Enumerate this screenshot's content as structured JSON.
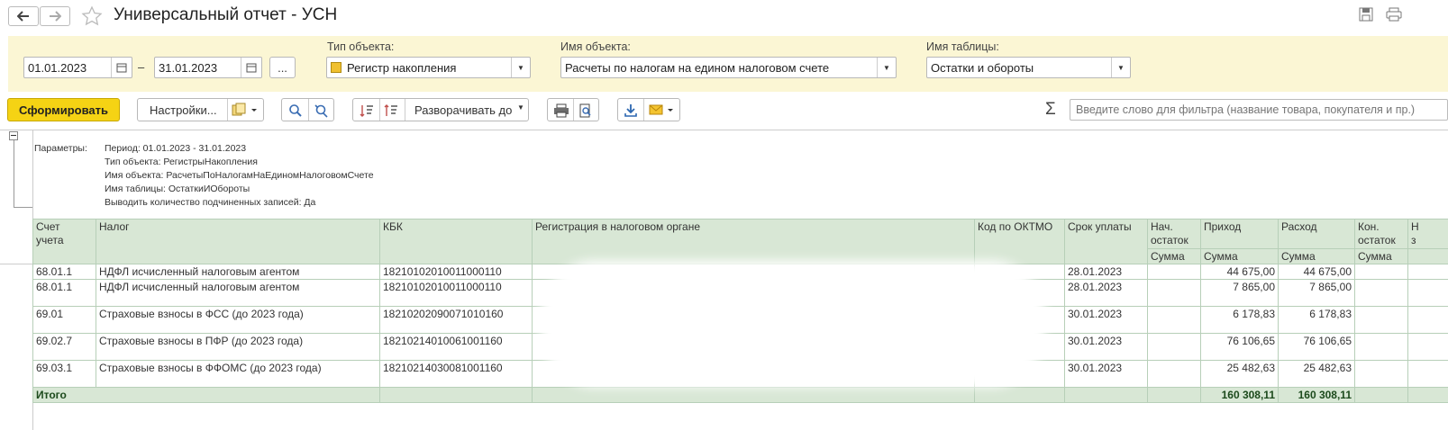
{
  "window": {
    "title": "Универсальный отчет - УСН"
  },
  "filters": {
    "date_from": "01.01.2023",
    "date_dash": "–",
    "date_to": "31.01.2023",
    "period_button": "...",
    "object_type_label": "Тип объекта:",
    "object_type_value": "Регистр накопления",
    "object_name_label": "Имя объекта:",
    "object_name_value": "Расчеты по налогам на едином налоговом счете",
    "table_name_label": "Имя таблицы:",
    "table_name_value": "Остатки и обороты"
  },
  "toolbar": {
    "generate_label": "Сформировать",
    "settings_label": "Настройки...",
    "expand_label": "Разворачивать до",
    "sum_symbol": "Σ",
    "search_placeholder": "Введите слово для фильтра (название товара, покупателя и пр.)"
  },
  "report": {
    "params_label": "Параметры:",
    "params": [
      "Период: 01.01.2023 - 31.01.2023",
      "Тип объекта: РегистрыНакопления",
      "Имя объекта: РасчетыПоНалогамНаЕдиномНалоговомСчете",
      "Имя таблицы: ОстаткиИОбороты",
      "Выводить количество подчиненных записей: Да"
    ],
    "headers": {
      "account_1": "Счет",
      "account_2": "учета",
      "tax": "Налог",
      "kbk": "КБК",
      "registration": "Регистрация в налоговом органе",
      "oktmo": "Код по ОКТМО",
      "due": "Срок уплаты",
      "start_1": "Нач.",
      "start_2": "остаток",
      "income": "Приход",
      "expense": "Расход",
      "end_1": "Кон.",
      "end_2": "остаток",
      "sum_start": "Сумма",
      "sum_income": "Сумма",
      "sum_expense": "Сумма",
      "sum_end": "Сумма",
      "cut_1": "Н",
      "cut_2": "з"
    },
    "rows": [
      {
        "account": "68.01.1",
        "tax": "НДФЛ исчисленный налоговым агентом",
        "kbk": "18210102010011000110",
        "due": "28.01.2023",
        "income": "44 675,00",
        "expense": "44 675,00"
      },
      {
        "account": "68.01.1",
        "tax": "НДФЛ исчисленный налоговым агентом",
        "kbk": "18210102010011000110",
        "due": "28.01.2023",
        "income": "7 865,00",
        "expense": "7 865,00"
      },
      {
        "account": "69.01",
        "tax": "Страховые взносы в ФСС (до 2023 года)",
        "kbk": "18210202090071010160",
        "due": "30.01.2023",
        "income": "6 178,83",
        "expense": "6 178,83"
      },
      {
        "account": "69.02.7",
        "tax": "Страховые взносы в ПФР (до 2023 года)",
        "kbk": "18210214010061001160",
        "due": "30.01.2023",
        "income": "76 106,65",
        "expense": "76 106,65"
      },
      {
        "account": "69.03.1",
        "tax": "Страховые взносы в ФФОМС (до 2023 года)",
        "kbk": "18210214030081001160",
        "due": "30.01.2023",
        "income": "25 482,63",
        "expense": "25 482,63"
      }
    ],
    "total": {
      "label": "Итого",
      "income": "160 308,11",
      "expense": "160 308,11"
    }
  }
}
